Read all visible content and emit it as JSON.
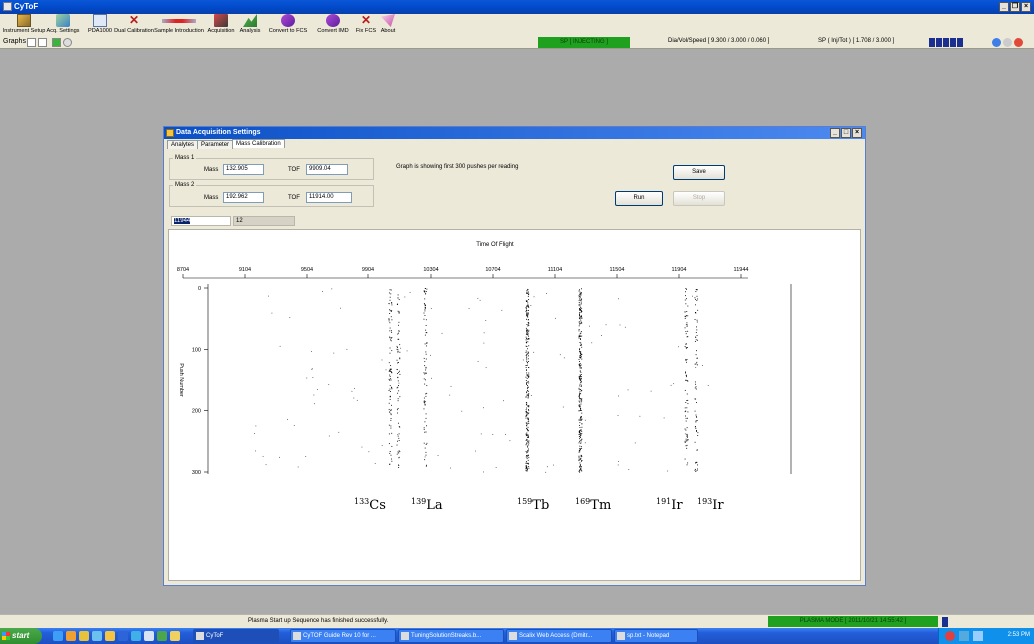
{
  "window": {
    "title": "CyToF",
    "controls": [
      "_",
      "×"
    ]
  },
  "toolbar": {
    "items": [
      {
        "label": "Instrument Setup",
        "icon": "instrument-setup-icon"
      },
      {
        "label": "Acq. Settings",
        "icon": "acq-settings-icon"
      },
      {
        "label": "PDA1000",
        "icon": "pda-icon"
      },
      {
        "label": "Dual Calibration",
        "icon": "dual-calibration-icon"
      },
      {
        "label": "Sample Introduction",
        "icon": "sample-introduction-icon"
      },
      {
        "label": "Acquisition",
        "icon": "acquisition-icon"
      },
      {
        "label": "Analysis",
        "icon": "analysis-icon"
      },
      {
        "label": "Convert to FCS",
        "icon": "convert-fcs-icon"
      },
      {
        "label": "Convert IMD",
        "icon": "convert-imd-icon"
      },
      {
        "label": "Fix FCS",
        "icon": "fix-fcs-icon"
      },
      {
        "label": "About",
        "icon": "about-icon"
      }
    ]
  },
  "graphs_row": {
    "label": "Graphs",
    "sp_status": "SP [ INJECTING ]",
    "dia_vol_speed": "Dia/Vol/Speed [ 9.300 / 3.000 / 0.060 ]",
    "sp_inj_tot": "SP ( Inj/Tot ) [ 1.708 / 3.000 ]"
  },
  "child": {
    "title": "Data Acquisition Settings",
    "tabs": [
      "Analytes",
      "Parameter",
      "Mass Calibration"
    ],
    "active_tab": "Mass Calibration",
    "mass1": {
      "legend": "Mass 1",
      "mass_label": "Mass",
      "mass": "132.905",
      "tof_label": "TOF",
      "tof": "9909.04"
    },
    "mass2": {
      "legend": "Mass 2",
      "mass_label": "Mass",
      "mass": "192.962",
      "tof_label": "TOF",
      "tof": "11914.00"
    },
    "note": "Graph is showing first 300 pushes per reading",
    "buttons": {
      "save": "Save",
      "run": "Run",
      "stop": "Stop"
    },
    "readout1": "11944",
    "readout2": "12"
  },
  "chart_data": {
    "type": "scatter",
    "title": "Time Of Flight",
    "xlabel": "",
    "ylabel": "Push Number",
    "x_ticks": [
      "8704",
      "9104",
      "9504",
      "9904",
      "10304",
      "10704",
      "11104",
      "11504",
      "11904",
      "11944"
    ],
    "y_ticks": [
      "0",
      "100",
      "200",
      "300"
    ],
    "ylim": [
      0,
      300
    ],
    "axis_position": "top",
    "dense_columns_tof": [
      9904,
      9944,
      10058,
      10734,
      11156,
      11902,
      11942
    ],
    "annotations": [
      {
        "iso": "133",
        "el": "Cs",
        "tof": 9904
      },
      {
        "iso": "139",
        "el": "La",
        "tof": 10058
      },
      {
        "iso": "159",
        "el": "Tb",
        "tof": 10734
      },
      {
        "iso": "169",
        "el": "Tm",
        "tof": 11156
      },
      {
        "iso": "191",
        "el": "Ir",
        "tof": 11902
      },
      {
        "iso": "193",
        "el": "Ir",
        "tof": 11942
      }
    ]
  },
  "status_bar": {
    "message": "Plasma Start up Sequence has finished successfully.",
    "mode": "PLASMA MODE [ 2011/10/21 14:55:42 ]"
  },
  "taskbar": {
    "start": "start",
    "tasks": [
      "CyToF",
      "CyTOF Guide Rev 10 for ...",
      "TuningSolutionStreaks.b...",
      "Scalix Web Access (Dmitr...",
      "sp.txt - Notepad"
    ],
    "clock": "2:53 PM"
  }
}
